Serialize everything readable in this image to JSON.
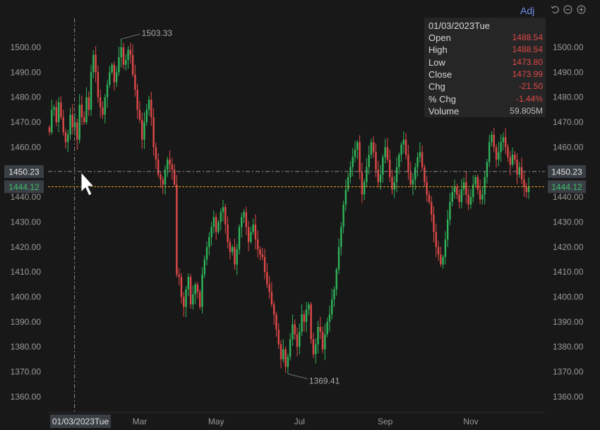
{
  "chart_data": {
    "type": "candlestick",
    "x_ticks": [
      "Mar",
      "May",
      "Jul",
      "Sep",
      "Nov"
    ],
    "y_ticks": [
      "1360.00",
      "1370.00",
      "1380.00",
      "1390.00",
      "1400.00",
      "1410.00",
      "1420.00",
      "1430.00",
      "1440.00",
      "1450.00",
      "1460.00",
      "1470.00",
      "1480.00",
      "1490.00",
      "1500.00"
    ],
    "ylim": [
      1354,
      1511
    ],
    "grid": false,
    "closes": [
      1466,
      1475,
      1476,
      1470,
      1478,
      1472,
      1466,
      1462,
      1465,
      1473,
      1468,
      1470,
      1463,
      1477,
      1472,
      1470,
      1480,
      1475,
      1490,
      1497,
      1490,
      1480,
      1476,
      1473,
      1480,
      1485,
      1490,
      1493,
      1486,
      1490,
      1496,
      1500,
      1493,
      1495,
      1499,
      1497,
      1489,
      1483,
      1475,
      1471,
      1463,
      1470,
      1475,
      1479,
      1472,
      1460,
      1455,
      1449,
      1447,
      1445,
      1451,
      1455,
      1453,
      1451,
      1445,
      1409,
      1408,
      1400,
      1396,
      1403,
      1408,
      1397,
      1401,
      1405,
      1402,
      1396,
      1409,
      1415,
      1420,
      1424,
      1428,
      1432,
      1426,
      1430,
      1434,
      1436,
      1429,
      1422,
      1418,
      1420,
      1413,
      1419,
      1428,
      1432,
      1434,
      1428,
      1422,
      1426,
      1429,
      1423,
      1419,
      1417,
      1416,
      1410,
      1405,
      1402,
      1397,
      1393,
      1387,
      1381,
      1375,
      1379,
      1372,
      1376,
      1383,
      1389,
      1385,
      1380,
      1386,
      1393,
      1390,
      1395,
      1397,
      1383,
      1377,
      1381,
      1388,
      1386,
      1379,
      1385,
      1390,
      1393,
      1399,
      1403,
      1411,
      1420,
      1428,
      1437,
      1443,
      1448,
      1452,
      1456,
      1459,
      1462,
      1450,
      1441,
      1446,
      1452,
      1457,
      1462,
      1458,
      1451,
      1446,
      1449,
      1456,
      1460,
      1455,
      1448,
      1443,
      1446,
      1452,
      1457,
      1461,
      1463,
      1457,
      1450,
      1445,
      1447,
      1452,
      1456,
      1458,
      1452,
      1446,
      1441,
      1438,
      1433,
      1426,
      1420,
      1417,
      1413,
      1416,
      1423,
      1431,
      1438,
      1442,
      1444,
      1441,
      1438,
      1443,
      1446,
      1441,
      1437,
      1440,
      1445,
      1448,
      1443,
      1439,
      1441,
      1448,
      1454,
      1462,
      1465,
      1460,
      1455,
      1458,
      1462,
      1464,
      1460,
      1456,
      1453,
      1457,
      1455,
      1449,
      1452,
      1447,
      1444,
      1442,
      1444
    ],
    "highlight": {
      "date": "01/03/2023Tue",
      "index": 11
    },
    "annotations": {
      "max_label": "1503.33",
      "min_label": "1369.41"
    },
    "crosshair": {
      "y": 1450.23,
      "label": "1450.23",
      "date_label": "01/03/2023Tue"
    },
    "last_price": {
      "y": 1444.12,
      "label": "1444.12"
    },
    "colors": {
      "up": "#2fb45a",
      "down": "#e04848",
      "crosshair": "#8a8a8a",
      "last_price": "#e0a020",
      "last_price_text": "#3dbf6a"
    }
  },
  "info_panel": {
    "date": "01/03/2023Tue",
    "rows": [
      {
        "label": "Open",
        "value": "1488.54",
        "color": "down"
      },
      {
        "label": "High",
        "value": "1488.54",
        "color": "down"
      },
      {
        "label": "Low",
        "value": "1473.80",
        "color": "down"
      },
      {
        "label": "Close",
        "value": "1473.99",
        "color": "down"
      },
      {
        "label": "Chg",
        "value": "-21.50",
        "color": "down"
      },
      {
        "label": "% Chg",
        "value": "-1.44%",
        "color": "down"
      },
      {
        "label": "Volume",
        "value": "59.805M",
        "color": "neutral"
      }
    ]
  },
  "toolbar": {
    "adj_label": "Adj",
    "icons": [
      "undo-icon",
      "zoom-out-icon",
      "zoom-in-icon"
    ]
  }
}
